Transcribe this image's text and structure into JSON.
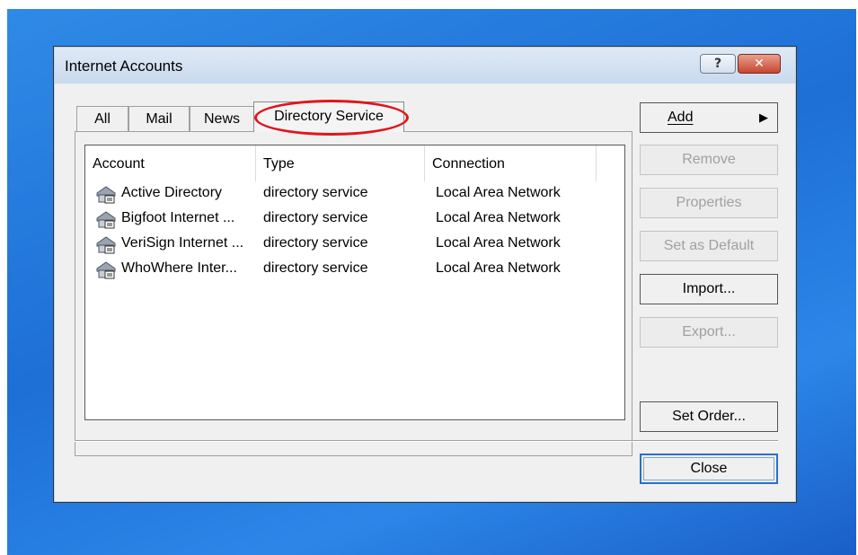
{
  "window": {
    "title": "Internet Accounts",
    "help_symbol": "?",
    "close_symbol": "✕"
  },
  "tabs": [
    {
      "label": "All"
    },
    {
      "label": "Mail"
    },
    {
      "label": "News"
    },
    {
      "label": "Directory Service",
      "selected": true,
      "highlighted": true
    }
  ],
  "list": {
    "columns": [
      "Account",
      "Type",
      "Connection"
    ],
    "rows": [
      {
        "account": "Active Directory",
        "type": "directory service",
        "connection": "Local Area Network",
        "icon": "directory-service-icon"
      },
      {
        "account": "Bigfoot Internet ...",
        "type": "directory service",
        "connection": "Local Area Network",
        "icon": "directory-service-icon"
      },
      {
        "account": "VeriSign Internet ...",
        "type": "directory service",
        "connection": "Local Area Network",
        "icon": "directory-service-icon"
      },
      {
        "account": "WhoWhere Inter...",
        "type": "directory service",
        "connection": "Local Area Network",
        "icon": "directory-service-icon"
      }
    ]
  },
  "buttons": {
    "add": "Add",
    "add_arrow": "▶",
    "remove": "Remove",
    "properties": "Properties",
    "set_default": "Set as Default",
    "import": "Import...",
    "export": "Export...",
    "set_order": "Set Order...",
    "close": "Close"
  },
  "colors": {
    "highlight": "#e0151c",
    "desktop": "#1e6fd6"
  }
}
